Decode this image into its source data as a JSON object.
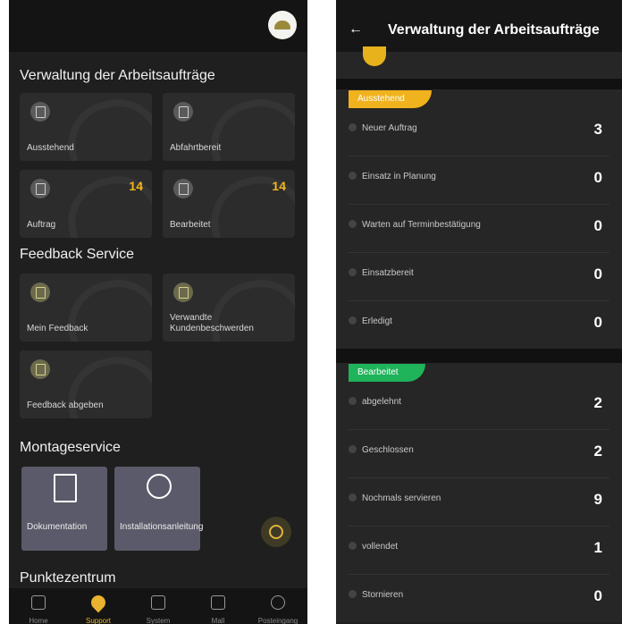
{
  "left": {
    "sections": {
      "work_orders": "Verwaltung der Arbeitsaufträge",
      "feedback": "Feedback Service",
      "assembly": "Montageservice",
      "points": "Punktezentrum"
    },
    "work_cards": [
      {
        "label": "Ausstehend",
        "count": ""
      },
      {
        "label": "Abfahrtbereit",
        "count": ""
      },
      {
        "label": "Auftrag",
        "count": "14"
      },
      {
        "label": "Bearbeitet",
        "count": "14"
      }
    ],
    "feedback_cards": [
      {
        "label": "Mein Feedback"
      },
      {
        "label": "Verwandte Kundenbeschwerden"
      },
      {
        "label": "Feedback abgeben"
      }
    ],
    "assembly_cards": [
      {
        "label": "Dokumentation"
      },
      {
        "label": "Installationsanleitung"
      }
    ],
    "tabs": [
      "Home",
      "Support",
      "System",
      "Mall",
      "Posteingang"
    ],
    "active_tab": "Support"
  },
  "right": {
    "title": "Verwaltung der Arbeitsaufträge",
    "back_icon": "←",
    "pending": {
      "badge": "Ausstehend",
      "rows": [
        {
          "label": "Neuer Auftrag",
          "value": "3"
        },
        {
          "label": "Einsatz in Planung",
          "value": "0"
        },
        {
          "label": "Warten auf Terminbestätigung",
          "value": "0"
        },
        {
          "label": "Einsatzbereit",
          "value": "0"
        },
        {
          "label": "Erledigt",
          "value": "0"
        }
      ]
    },
    "processed": {
      "badge": "Bearbeitet",
      "rows": [
        {
          "label": "abgelehnt",
          "value": "2"
        },
        {
          "label": "Geschlossen",
          "value": "2"
        },
        {
          "label": "Nochmals servieren",
          "value": "9"
        },
        {
          "label": "vollendet",
          "value": "1"
        },
        {
          "label": "Stornieren",
          "value": "0"
        }
      ]
    }
  },
  "colors": {
    "accent": "#f0b21d",
    "green": "#1fb35a",
    "bg": "#1f1f1f"
  }
}
